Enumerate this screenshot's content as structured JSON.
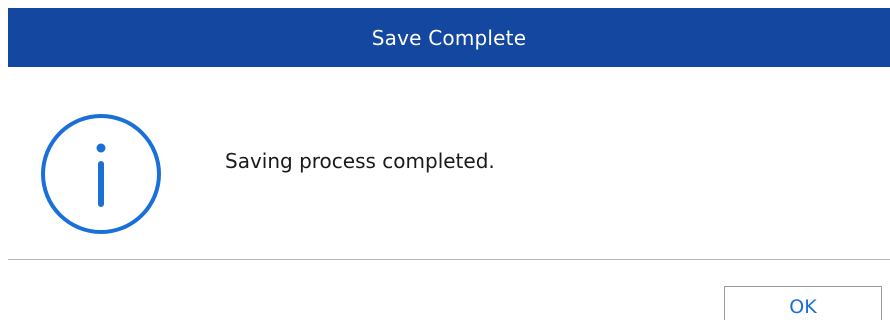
{
  "dialog": {
    "title": "Save Complete",
    "message": "Saving process completed.",
    "icon": "info-icon",
    "ok_label": "OK"
  },
  "colors": {
    "titlebar": "#1448a0",
    "title_text": "#ffffff",
    "icon": "#1a6fd8",
    "ok_text": "#1a6fd8",
    "divider": "#b8b8b8"
  }
}
